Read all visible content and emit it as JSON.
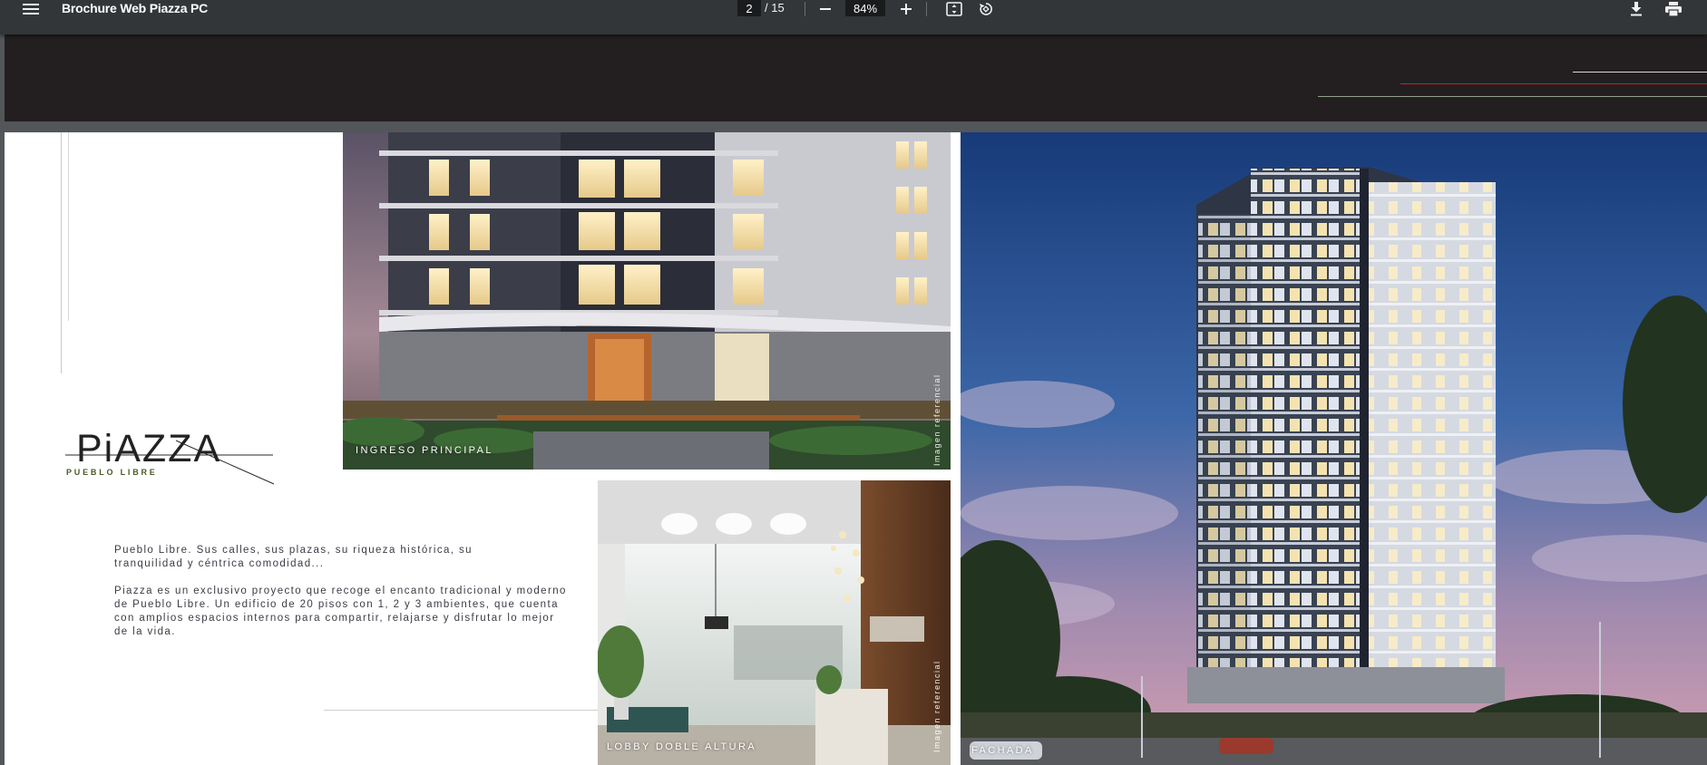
{
  "toolbar": {
    "title": "Brochure Web Piazza PC",
    "current_page": "2",
    "page_total": "/ 15",
    "zoom": "84%",
    "icons": [
      "menu-icon",
      "zoom-out-icon",
      "zoom-in-icon",
      "fit-page-icon",
      "rotate-icon",
      "download-icon",
      "print-icon"
    ]
  },
  "brochure": {
    "logo_main": "PiAZZA",
    "logo_sub": "PUEBLO LIBRE",
    "intro_text": "Pueblo Libre. Sus calles, sus plazas, su riqueza histórica, su tranquilidad y céntrica comodidad...",
    "body_text": "Piazza es un exclusivo proyecto que recoge el encanto tradicional y moderno de Pueblo Libre. Un edificio de 20 pisos con 1, 2 y 3 ambientes, que cuenta con amplios espacios internos para compartir, relajarse y disfrutar lo mejor de la vida.",
    "photo_entrance_caption": "INGRESO PRINCIPAL",
    "photo_lobby_caption": "LOBBY DOBLE ALTURA",
    "photo_facade_caption": "FACHADA",
    "reference_note": "Imagen referencial"
  },
  "colors": {
    "toolbar_bg": "#323639",
    "viewer_bg": "#525659",
    "prev_page_bg": "#231f20",
    "accent_red": "#c8202a",
    "logo_green": "#4a5a2a"
  }
}
